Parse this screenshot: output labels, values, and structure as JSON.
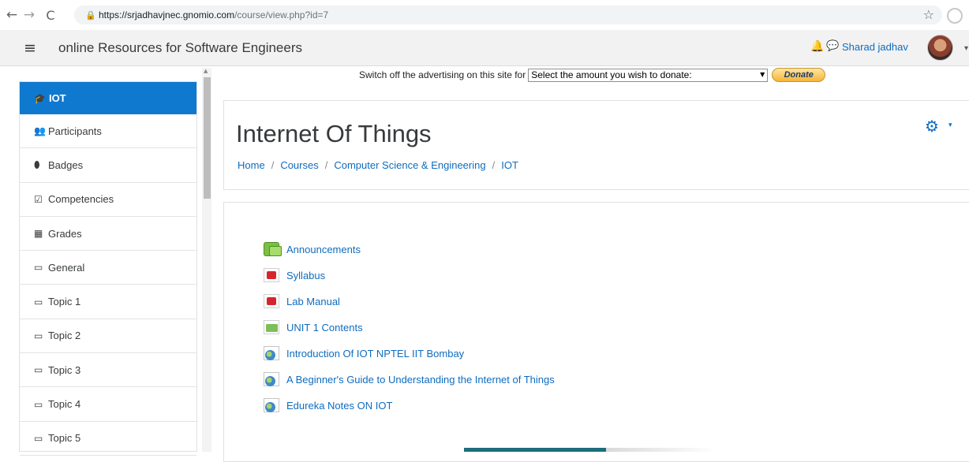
{
  "browser": {
    "back_icon": "←",
    "forward_icon": "→",
    "reload_icon": "C",
    "lock_icon": "🔒",
    "url_host": "https://srjadhavjnec.gnomio.com",
    "url_path": "/course/view.php?id=7",
    "star_icon": "☆"
  },
  "navbar": {
    "menu_icon": "≡",
    "site_name": "online Resources for Software Engineers",
    "bell_icon": "🔔",
    "chat_icon": "💬",
    "user_name": "Sharad jadhav",
    "user_caret": "▾"
  },
  "sidebar": {
    "active": {
      "icon": "🎓",
      "label": "IOT"
    },
    "items": [
      {
        "icon": "👥",
        "label": "Participants"
      },
      {
        "icon": "⬮",
        "label": "Badges"
      },
      {
        "icon": "☑",
        "label": "Competencies"
      },
      {
        "icon": "▦",
        "label": "Grades"
      },
      {
        "icon": "▭",
        "label": "General"
      },
      {
        "icon": "▭",
        "label": "Topic 1"
      },
      {
        "icon": "▭",
        "label": "Topic 2"
      },
      {
        "icon": "▭",
        "label": "Topic 3"
      },
      {
        "icon": "▭",
        "label": "Topic 4"
      },
      {
        "icon": "▭",
        "label": "Topic 5"
      }
    ]
  },
  "donate": {
    "text": "Switch off the advertising on this site for",
    "select_value": "Select the amount you wish to donate:",
    "button_label": "Donate"
  },
  "course": {
    "title": "Internet Of Things",
    "breadcrumb": [
      "Home",
      "Courses",
      "Computer Science & Engineering",
      "IOT"
    ],
    "breadcrumb_sep": "/",
    "gear_icon": "⚙",
    "gear_caret": "▾"
  },
  "resources": [
    {
      "type": "forum",
      "label": "Announcements"
    },
    {
      "type": "pdf",
      "label": "Syllabus"
    },
    {
      "type": "pdf",
      "label": "Lab Manual"
    },
    {
      "type": "xls",
      "label": "UNIT 1 Contents"
    },
    {
      "type": "url",
      "label": "Introduction Of IOT NPTEL IIT Bombay"
    },
    {
      "type": "url",
      "label": "A Beginner's Guide to Understanding the Internet of Things"
    },
    {
      "type": "url",
      "label": "Edureka Notes ON IOT"
    }
  ]
}
